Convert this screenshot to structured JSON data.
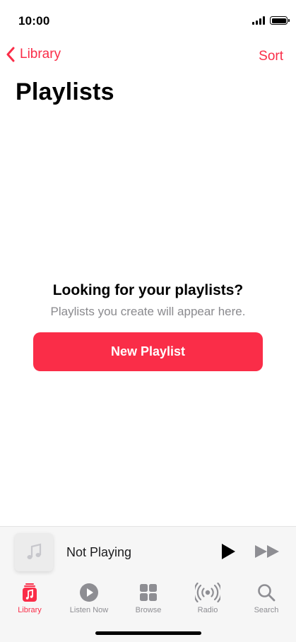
{
  "status_bar": {
    "time": "10:00"
  },
  "nav": {
    "back_label": "Library",
    "sort_label": "Sort"
  },
  "page": {
    "title": "Playlists"
  },
  "empty_state": {
    "heading": "Looking for your playlists?",
    "subtitle": "Playlists you create will appear here.",
    "button_label": "New Playlist"
  },
  "mini_player": {
    "title": "Not Playing"
  },
  "tabs": [
    {
      "label": "Library",
      "icon": "library-icon",
      "active": true
    },
    {
      "label": "Listen Now",
      "icon": "play-circle-icon",
      "active": false
    },
    {
      "label": "Browse",
      "icon": "grid-icon",
      "active": false
    },
    {
      "label": "Radio",
      "icon": "radio-icon",
      "active": false
    },
    {
      "label": "Search",
      "icon": "search-icon",
      "active": false
    }
  ],
  "colors": {
    "accent": "#fa2d48",
    "inactive": "#8e8e93",
    "background": "#ffffff"
  }
}
